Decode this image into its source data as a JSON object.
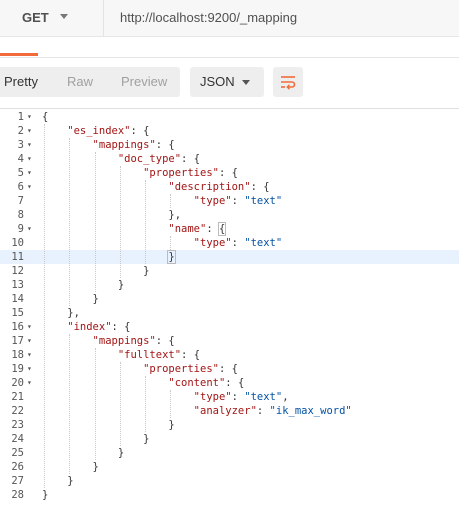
{
  "request": {
    "method": "GET",
    "url": "http://localhost:9200/_mapping"
  },
  "view": {
    "tabs": [
      "Pretty",
      "Raw",
      "Preview"
    ],
    "active_tab": "Pretty",
    "format": "JSON",
    "wrap_icon": "wrap-lines-icon"
  },
  "colors": {
    "accent": "#f26b3a",
    "key": "#a31515",
    "string": "#0451a5"
  },
  "editor": {
    "cursor_line": 11,
    "lines": [
      {
        "n": "1",
        "fold": true,
        "indent": 0,
        "t": [
          [
            "p",
            "{"
          ]
        ]
      },
      {
        "n": "2",
        "fold": true,
        "indent": 1,
        "t": [
          [
            "k",
            "\"es_index\""
          ],
          [
            "p",
            ": {"
          ]
        ]
      },
      {
        "n": "3",
        "fold": true,
        "indent": 2,
        "t": [
          [
            "k",
            "\"mappings\""
          ],
          [
            "p",
            ": {"
          ]
        ]
      },
      {
        "n": "4",
        "fold": true,
        "indent": 3,
        "t": [
          [
            "k",
            "\"doc_type\""
          ],
          [
            "p",
            ": {"
          ]
        ]
      },
      {
        "n": "5",
        "fold": true,
        "indent": 4,
        "t": [
          [
            "k",
            "\"properties\""
          ],
          [
            "p",
            ": {"
          ]
        ]
      },
      {
        "n": "6",
        "fold": true,
        "indent": 5,
        "t": [
          [
            "k",
            "\"description\""
          ],
          [
            "p",
            ": {"
          ]
        ]
      },
      {
        "n": "7",
        "fold": false,
        "indent": 6,
        "t": [
          [
            "k",
            "\"type\""
          ],
          [
            "p",
            ": "
          ],
          [
            "s",
            "\"text\""
          ]
        ]
      },
      {
        "n": "8",
        "fold": false,
        "indent": 5,
        "t": [
          [
            "p",
            "},"
          ]
        ]
      },
      {
        "n": "9",
        "fold": true,
        "indent": 5,
        "t": [
          [
            "k",
            "\"name\""
          ],
          [
            "p",
            ": "
          ],
          [
            "h",
            "{"
          ]
        ]
      },
      {
        "n": "10",
        "fold": false,
        "indent": 6,
        "t": [
          [
            "k",
            "\"type\""
          ],
          [
            "p",
            ": "
          ],
          [
            "s",
            "\"text\""
          ]
        ]
      },
      {
        "n": "11",
        "fold": false,
        "indent": 5,
        "t": [
          [
            "h",
            "}"
          ],
          [
            "c",
            ""
          ]
        ]
      },
      {
        "n": "12",
        "fold": false,
        "indent": 4,
        "t": [
          [
            "p",
            "}"
          ]
        ]
      },
      {
        "n": "13",
        "fold": false,
        "indent": 3,
        "t": [
          [
            "p",
            "}"
          ]
        ]
      },
      {
        "n": "14",
        "fold": false,
        "indent": 2,
        "t": [
          [
            "p",
            "}"
          ]
        ]
      },
      {
        "n": "15",
        "fold": false,
        "indent": 1,
        "t": [
          [
            "p",
            "},"
          ]
        ]
      },
      {
        "n": "16",
        "fold": true,
        "indent": 1,
        "t": [
          [
            "k",
            "\"index\""
          ],
          [
            "p",
            ": {"
          ]
        ]
      },
      {
        "n": "17",
        "fold": true,
        "indent": 2,
        "t": [
          [
            "k",
            "\"mappings\""
          ],
          [
            "p",
            ": {"
          ]
        ]
      },
      {
        "n": "18",
        "fold": true,
        "indent": 3,
        "t": [
          [
            "k",
            "\"fulltext\""
          ],
          [
            "p",
            ": {"
          ]
        ]
      },
      {
        "n": "19",
        "fold": true,
        "indent": 4,
        "t": [
          [
            "k",
            "\"properties\""
          ],
          [
            "p",
            ": {"
          ]
        ]
      },
      {
        "n": "20",
        "fold": true,
        "indent": 5,
        "t": [
          [
            "k",
            "\"content\""
          ],
          [
            "p",
            ": {"
          ]
        ]
      },
      {
        "n": "21",
        "fold": false,
        "indent": 6,
        "t": [
          [
            "k",
            "\"type\""
          ],
          [
            "p",
            ": "
          ],
          [
            "s",
            "\"text\""
          ],
          [
            "p",
            ","
          ]
        ]
      },
      {
        "n": "22",
        "fold": false,
        "indent": 6,
        "t": [
          [
            "k",
            "\"analyzer\""
          ],
          [
            "p",
            ": "
          ],
          [
            "s",
            "\"ik_max_word\""
          ]
        ]
      },
      {
        "n": "23",
        "fold": false,
        "indent": 5,
        "t": [
          [
            "p",
            "}"
          ]
        ]
      },
      {
        "n": "24",
        "fold": false,
        "indent": 4,
        "t": [
          [
            "p",
            "}"
          ]
        ]
      },
      {
        "n": "25",
        "fold": false,
        "indent": 3,
        "t": [
          [
            "p",
            "}"
          ]
        ]
      },
      {
        "n": "26",
        "fold": false,
        "indent": 2,
        "t": [
          [
            "p",
            "}"
          ]
        ]
      },
      {
        "n": "27",
        "fold": false,
        "indent": 1,
        "t": [
          [
            "p",
            "}"
          ]
        ]
      },
      {
        "n": "28",
        "fold": false,
        "indent": 0,
        "t": [
          [
            "p",
            "}"
          ]
        ]
      }
    ]
  }
}
